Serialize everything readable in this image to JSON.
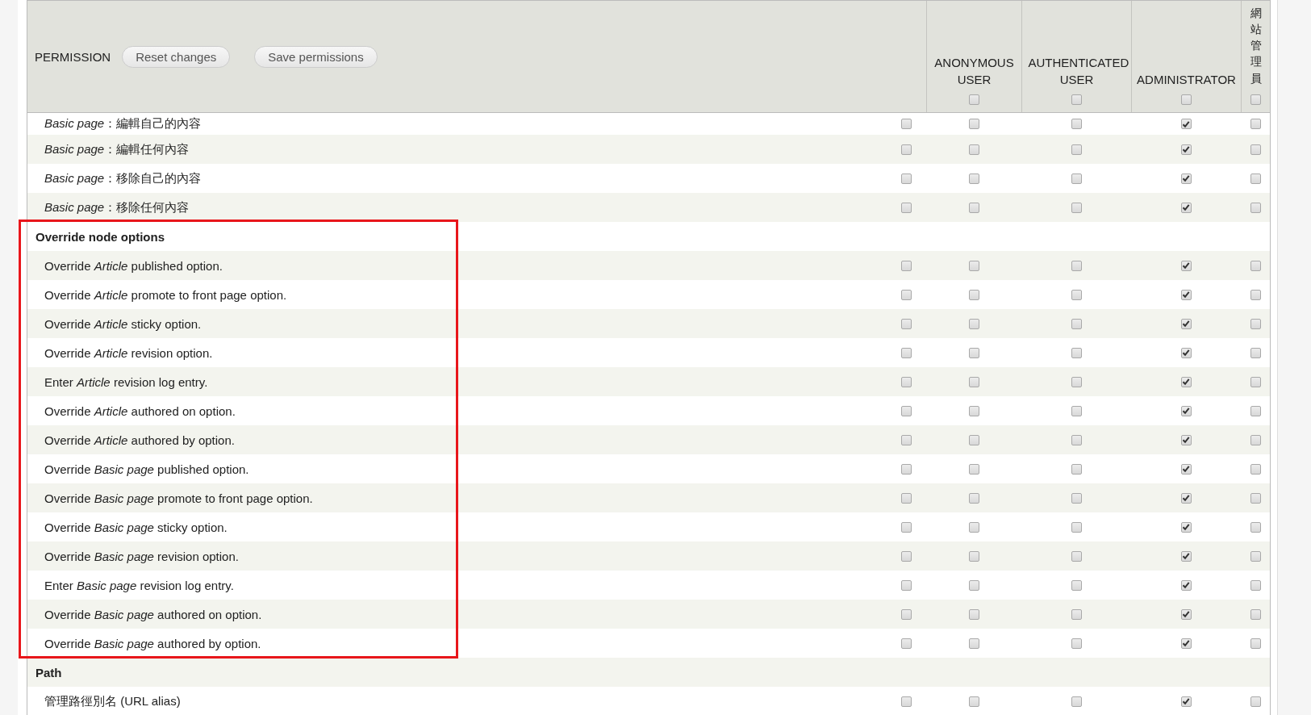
{
  "header": {
    "title": "PERMISSION",
    "buttons": [
      "Reset changes",
      "Save permissions"
    ],
    "roles": [
      {
        "label": "ANONYMOUS USER",
        "kind": "horizontal",
        "checked": false
      },
      {
        "label": "AUTHENTICATED USER",
        "kind": "horizontal",
        "checked": false
      },
      {
        "label": "ADMINISTRATOR",
        "kind": "horizontal",
        "checked": false
      },
      {
        "label": "網站管理員",
        "kind": "vertical",
        "checked": false
      }
    ]
  },
  "rows": [
    {
      "kind": "permission",
      "label": "*Basic page*：編輯自己的內容",
      "checks": [
        false,
        false,
        false,
        true,
        false
      ]
    },
    {
      "kind": "permission",
      "label": "*Basic page*：編輯任何內容",
      "checks": [
        false,
        false,
        false,
        true,
        false
      ]
    },
    {
      "kind": "permission",
      "label": "*Basic page*：移除自己的內容",
      "checks": [
        false,
        false,
        false,
        true,
        false
      ]
    },
    {
      "kind": "permission",
      "label": "*Basic page*：移除任何內容",
      "checks": [
        false,
        false,
        false,
        true,
        false
      ]
    },
    {
      "kind": "group",
      "label": "Override node options"
    },
    {
      "kind": "permission",
      "label": "Override *Article* published option.",
      "checks": [
        false,
        false,
        false,
        true,
        false
      ]
    },
    {
      "kind": "permission",
      "label": "Override *Article* promote to front page option.",
      "checks": [
        false,
        false,
        false,
        true,
        false
      ]
    },
    {
      "kind": "permission",
      "label": "Override *Article* sticky option.",
      "checks": [
        false,
        false,
        false,
        true,
        false
      ]
    },
    {
      "kind": "permission",
      "label": "Override *Article* revision option.",
      "checks": [
        false,
        false,
        false,
        true,
        false
      ]
    },
    {
      "kind": "permission",
      "label": "Enter *Article* revision log entry.",
      "checks": [
        false,
        false,
        false,
        true,
        false
      ]
    },
    {
      "kind": "permission",
      "label": "Override *Article* authored on option.",
      "checks": [
        false,
        false,
        false,
        true,
        false
      ]
    },
    {
      "kind": "permission",
      "label": "Override *Article* authored by option.",
      "checks": [
        false,
        false,
        false,
        true,
        false
      ]
    },
    {
      "kind": "permission",
      "label": "Override *Basic page* published option.",
      "checks": [
        false,
        false,
        false,
        true,
        false
      ]
    },
    {
      "kind": "permission",
      "label": "Override *Basic page* promote to front page option.",
      "checks": [
        false,
        false,
        false,
        true,
        false
      ]
    },
    {
      "kind": "permission",
      "label": "Override *Basic page* sticky option.",
      "checks": [
        false,
        false,
        false,
        true,
        false
      ]
    },
    {
      "kind": "permission",
      "label": "Override *Basic page* revision option.",
      "checks": [
        false,
        false,
        false,
        true,
        false
      ]
    },
    {
      "kind": "permission",
      "label": "Enter *Basic page* revision log entry.",
      "checks": [
        false,
        false,
        false,
        true,
        false
      ]
    },
    {
      "kind": "permission",
      "label": "Override *Basic page* authored on option.",
      "checks": [
        false,
        false,
        false,
        true,
        false
      ]
    },
    {
      "kind": "permission",
      "label": "Override *Basic page* authored by option.",
      "checks": [
        false,
        false,
        false,
        true,
        false
      ]
    },
    {
      "kind": "group",
      "label": "Path"
    },
    {
      "kind": "permission",
      "label": "管理路徑別名 (URL alias)",
      "checks": [
        false,
        false,
        false,
        true,
        false
      ]
    }
  ]
}
